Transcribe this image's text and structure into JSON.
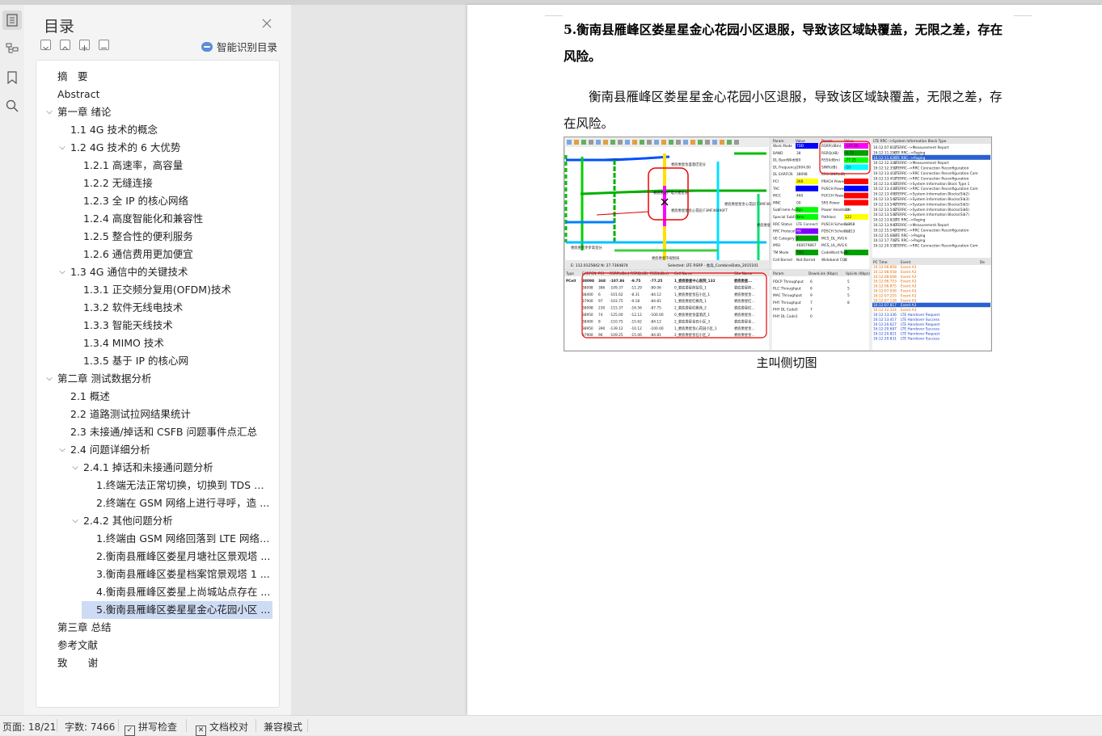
{
  "nav": {
    "title": "目录",
    "smart_label": "智能识别目录",
    "items": [
      {
        "label": "摘　要",
        "level": 0,
        "chevron": ""
      },
      {
        "label": "Abstract",
        "level": 0,
        "chevron": ""
      },
      {
        "label": "第一章 绪论",
        "level": 0,
        "chevron": "open"
      },
      {
        "label": "1.1 4G 技术的概念",
        "level": 1,
        "chevron": ""
      },
      {
        "label": "1.2 4G 技术的 6 大优势",
        "level": 1,
        "chevron": "open"
      },
      {
        "label": "1.2.1 高速率，高容量",
        "level": 2,
        "chevron": ""
      },
      {
        "label": "1.2.2 无缝连接",
        "level": 2,
        "chevron": ""
      },
      {
        "label": "1.2.3 全 IP 的核心网络",
        "level": 2,
        "chevron": ""
      },
      {
        "label": "1.2.4 高度智能化和兼容性",
        "level": 2,
        "chevron": ""
      },
      {
        "label": "1.2.5 整合性的便利服务",
        "level": 2,
        "chevron": ""
      },
      {
        "label": "1.2.6 通信费用更加便宜",
        "level": 2,
        "chevron": ""
      },
      {
        "label": "1.3 4G 通信中的关键技术",
        "level": 1,
        "chevron": "open"
      },
      {
        "label": "1.3.1  正交频分复用(OFDM)技术",
        "level": 2,
        "chevron": ""
      },
      {
        "label": "1.3.2  软件无线电技术",
        "level": 2,
        "chevron": ""
      },
      {
        "label": "1.3.3  智能天线技术",
        "level": 2,
        "chevron": ""
      },
      {
        "label": "1.3.4 MIMO 技术",
        "level": 2,
        "chevron": ""
      },
      {
        "label": "1.3.5  基于 IP 的核心网",
        "level": 2,
        "chevron": ""
      },
      {
        "label": "第二章 测试数据分析",
        "level": 0,
        "chevron": "open"
      },
      {
        "label": "2.1 概述",
        "level": 1,
        "chevron": ""
      },
      {
        "label": "2.2 道路测试拉网结果统计",
        "level": 1,
        "chevron": ""
      },
      {
        "label": "2.3 未接通/掉话和 CSFB 问题事件点汇总",
        "level": 1,
        "chevron": ""
      },
      {
        "label": "2.4 问题详细分析",
        "level": 1,
        "chevron": "open"
      },
      {
        "label": "2.4.1 掉话和未接通问题分析",
        "level": 2,
        "chevron": "open"
      },
      {
        "label": "1.终端无法正常切换，切换到 TDS 网 ...",
        "level": 3,
        "chevron": ""
      },
      {
        "label": "2.终端在 GSM 网络上进行寻呼，造 ...",
        "level": 3,
        "chevron": ""
      },
      {
        "label": "2.4.2 其他问题分析",
        "level": 2,
        "chevron": "open"
      },
      {
        "label": "1.终端由 GSM 网络回落到 LTE 网络 ...",
        "level": 3,
        "chevron": ""
      },
      {
        "label": "2.衡南县雁峰区娄星月塘社区景观塔 ...",
        "level": 3,
        "chevron": ""
      },
      {
        "label": "3.衡南县雁峰区娄星档案馆景观塔 1 ...",
        "level": 3,
        "chevron": ""
      },
      {
        "label": "4.衡南县雁峰区娄星上尚城站点存在 ...",
        "level": 3,
        "chevron": ""
      },
      {
        "label": "5.衡南县雁峰区娄星星金心花园小区 ...",
        "level": 3,
        "chevron": "",
        "active": true
      },
      {
        "label": "第三章  总结",
        "level": 0,
        "chevron": ""
      },
      {
        "label": "参考文献",
        "level": 0,
        "chevron": ""
      },
      {
        "label": "致　　谢",
        "level": 0,
        "chevron": ""
      }
    ]
  },
  "doc": {
    "heading": "5.衡南县雁峰区娄星星金心花园小区退服，导致该区域缺覆盖，无限之差，存在风险。",
    "paragraph": "衡南县雁峰区娄星星金心花园小区退服，导致该区域缺覆盖，无限之差，存在风险。",
    "caption": "主叫侧切图"
  },
  "figure": {
    "coords": "E:  112.0125842  N:  27.7364874",
    "selected": "Selected: LTE RSRP - 会兵_CombineData_2015101",
    "map_labels": [
      "娄底娄星金盛酒店室分",
      "娄底娄星广电大楼室分",
      "娄底娄星星金心花园 F3MF46490FT",
      "娄底娄星星金心花园 F3MF46490F1",
      "娄底娄星步步高室分",
      "娄底娄星市规划局",
      "娄底娄星...区"
    ],
    "param_headers": [
      "Param",
      "Value",
      "Param",
      "Value"
    ],
    "params": [
      [
        "Work Mode",
        "TDD",
        "RSRP(dBm)",
        "-107.86"
      ],
      [
        "BAND",
        "38",
        "RSRQ(dB)",
        "-9.75"
      ],
      [
        "DL BandWidth",
        "20",
        "RSSI(dBm)",
        "-77.25"
      ],
      [
        "DL Frequency",
        "2604.80",
        "SINR(dB)",
        "-10"
      ],
      [
        "DL EARFCN",
        "38098",
        "CRS-SINR(dB)",
        ""
      ],
      [
        "PCI",
        "368",
        "PRACH Power",
        ""
      ],
      [
        "TAC",
        "",
        "PUSCH Power",
        ""
      ],
      [
        "MCC",
        "460",
        "PUCCH Power",
        ""
      ],
      [
        "MNC",
        "00",
        "SRS Power",
        ""
      ],
      [
        "SubFrame Assign",
        "2",
        "Power Headroom",
        "10"
      ],
      [
        "Special SubFrame",
        "7",
        "Pathloss",
        "122"
      ],
      [
        "RRC Status",
        "LTE Connect",
        "PUSCH Schedule",
        "1.768"
      ],
      [
        "RRC Protocol",
        "R9",
        "PDSCH Schedule",
        "1.213"
      ],
      [
        "UE Category",
        "4",
        "MCS_DL_AVG",
        "6"
      ],
      [
        "IMSI",
        "460079867",
        "MCS_UL_AVG",
        "6"
      ],
      [
        "TM Mode",
        "TM2",
        "CodeWord Num",
        "1"
      ],
      [
        "Cell Barred",
        "Not Barred",
        "Wideband CQI",
        "8"
      ]
    ],
    "msg_header": "LTE RRC-->System Information Block Type",
    "messages": [
      [
        "16:12:07.817",
        "LTERRC-->Measurement Report"
      ],
      [
        "16:12:11.296",
        "LTE RRC-->Paging"
      ],
      [
        "16:12:11.626",
        "LTE RRC-->Paging"
      ],
      [
        "16:12:12.324",
        "LTERRC-->Measurement Report"
      ],
      [
        "16:12:12.359",
        "LTERRC-->RRC Connection Reconfiguration"
      ],
      [
        "16:12:13.417",
        "LTERRC-->RRC Connection Reconfiguration Com"
      ],
      [
        "16:12:13.417",
        "LTERRC-->RRC Connection Reconfiguration"
      ],
      [
        "16:12:13.433",
        "LTERRC-->System Information Block Type 1"
      ],
      [
        "16:12:13.433",
        "LTERRC-->RRC Connection Reconfiguration Com"
      ],
      [
        "16:12:13.495",
        "LTERRC-->System Information Blocks(Sib2)"
      ],
      [
        "16:12:13.542",
        "LTERRC-->System Information Blocks(Sib3)"
      ],
      [
        "16:12:13.542",
        "LTERRC-->System Information Blocks(Sib5)"
      ],
      [
        "16:12:13.542",
        "LTERRC-->System Information Blocks(Sib6)"
      ],
      [
        "16:12:13.542",
        "LTERRC-->System Information Blocks(Sib7)"
      ],
      [
        "16:12:13.823",
        "LTE RRC-->Paging"
      ],
      [
        "16:12:13.940",
        "LTERRC-->Measurement Report"
      ],
      [
        "16:12:15.542",
        "LTERRC-->RRC Connection Reconfiguration"
      ],
      [
        "16:12:15.683",
        "LTE RRC-->Paging"
      ],
      [
        "16:12:17.702",
        "LTE RRC-->Paging"
      ],
      [
        "16:12:20.551",
        "LTERRC-->RRC Connection Reconfiguration Com"
      ]
    ],
    "cell_headers": [
      "Type",
      "EARFCN",
      "PCI",
      "RSRP(dBm)",
      "RSRQ(dB)",
      "RSSI(dBm)",
      "Cell Name",
      "Site Name"
    ],
    "cells": [
      [
        "PCell",
        "38098",
        "368",
        "-107.86",
        "-9.75",
        "-77.25",
        "1_娄底娄星中心医院_132",
        "娄底娄星..."
      ],
      [
        "",
        "38098",
        "386",
        "-109.37",
        "-11.29",
        "-89.06",
        "0_娄底娄星药监局_1",
        "娄底娄星药..."
      ],
      [
        "",
        "38400",
        "6",
        "-101.62",
        "-8.31",
        "-84.12",
        "1_娄底娄星金石小区_1",
        "娄底娄星金..."
      ],
      [
        "",
        "37900",
        "97",
        "-103.75",
        "-9.18",
        "-84.81",
        "1_娄底娄星红枫苑_1",
        "娄底娄星红..."
      ],
      [
        "",
        "38098",
        "230",
        "-115.37",
        "-16.56",
        "-87.75",
        "2_娄底娄星红枫苑_2",
        "娄底娄星红..."
      ],
      [
        "",
        "38950",
        "74",
        "-125.00",
        "-12.12",
        "-100.00",
        "0_娄底娄星金盛酒店_1",
        "娄底娄星金..."
      ],
      [
        "",
        "38400",
        "8",
        "-110.75",
        "-15.62",
        "-84.12",
        "2_娄底娄星金石小区_3",
        "娄底娄星金..."
      ],
      [
        "",
        "38950",
        "390",
        "-139.12",
        "-10.12",
        "-100.00",
        "1_娄底娄星金心花园小区_1",
        "娄底娄星金..."
      ],
      [
        "",
        "37900",
        "96",
        "-109.25",
        "-15.06",
        "-84.81",
        "2_娄底娄星金石小区_2",
        "娄底娄星金..."
      ]
    ],
    "tput_headers": [
      "Param",
      "DownLink (Kbps)",
      "UpLink (Kbps)"
    ],
    "tput": [
      [
        "PDCP Throughput",
        "6",
        "5"
      ],
      [
        "RLC Throughput",
        "6",
        "5"
      ],
      [
        "MAC Throughput",
        "9",
        "5"
      ],
      [
        "PHY Throughput",
        "7",
        "8"
      ],
      [
        "PHY DL Code0",
        "7",
        ""
      ],
      [
        "PHY DL Code1",
        "0",
        ""
      ]
    ],
    "event_headers": [
      "PC Time",
      "Event",
      "De"
    ],
    "events": [
      [
        "16:12:06.858",
        "Event A3"
      ],
      [
        "16:12:08.058",
        "Event A3"
      ],
      [
        "16:12:08.608",
        "Event A3"
      ],
      [
        "16:12:06.753",
        "Event A3"
      ],
      [
        "16:12:06.875",
        "Event A3"
      ],
      [
        "16:12:07.056",
        "Event A3"
      ],
      [
        "16:12:07.255",
        "Event A3"
      ],
      [
        "16:12:07.128",
        "Event A3"
      ],
      [
        "16:12:07.817",
        "Event A3"
      ],
      [
        "16:12:12.324",
        "Event A3"
      ],
      [
        "16:12:13.336",
        "LTE Handover Request"
      ],
      [
        "16:12:13.417",
        "LTE Handover Success"
      ],
      [
        "16:12:20.627",
        "LTE Handover Request"
      ],
      [
        "16:12:20.687",
        "LTE Handover Success"
      ],
      [
        "16:12:20.821",
        "LTE Handover Request"
      ],
      [
        "16:12:20.831",
        "LTE Handover Success"
      ]
    ]
  },
  "status": {
    "page": "页面: 18/21",
    "words": "字数: 7466",
    "spell": "拼写检查",
    "review": "文档校对",
    "compat": "兼容模式"
  }
}
